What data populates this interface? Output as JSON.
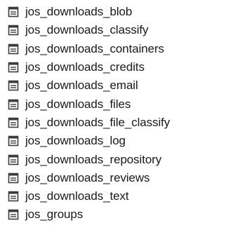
{
  "tables": [
    {
      "name": "jos_downloads_blob",
      "icon": "table-icon"
    },
    {
      "name": "jos_downloads_classify",
      "icon": "table-icon"
    },
    {
      "name": "jos_downloads_containers",
      "icon": "table-icon"
    },
    {
      "name": "jos_downloads_credits",
      "icon": "table-icon"
    },
    {
      "name": "jos_downloads_email",
      "icon": "table-icon"
    },
    {
      "name": "jos_downloads_files",
      "icon": "table-icon"
    },
    {
      "name": "jos_downloads_file_classify",
      "icon": "table-icon"
    },
    {
      "name": "jos_downloads_log",
      "icon": "table-icon"
    },
    {
      "name": "jos_downloads_repository",
      "icon": "table-icon"
    },
    {
      "name": "jos_downloads_reviews",
      "icon": "table-icon"
    },
    {
      "name": "jos_downloads_text",
      "icon": "table-icon"
    },
    {
      "name": "jos_groups",
      "icon": "table-icon"
    }
  ],
  "colors": {
    "text": "#1a1a1a",
    "icon_stroke": "#3c3c3c",
    "icon_fill": "#ffffff"
  }
}
